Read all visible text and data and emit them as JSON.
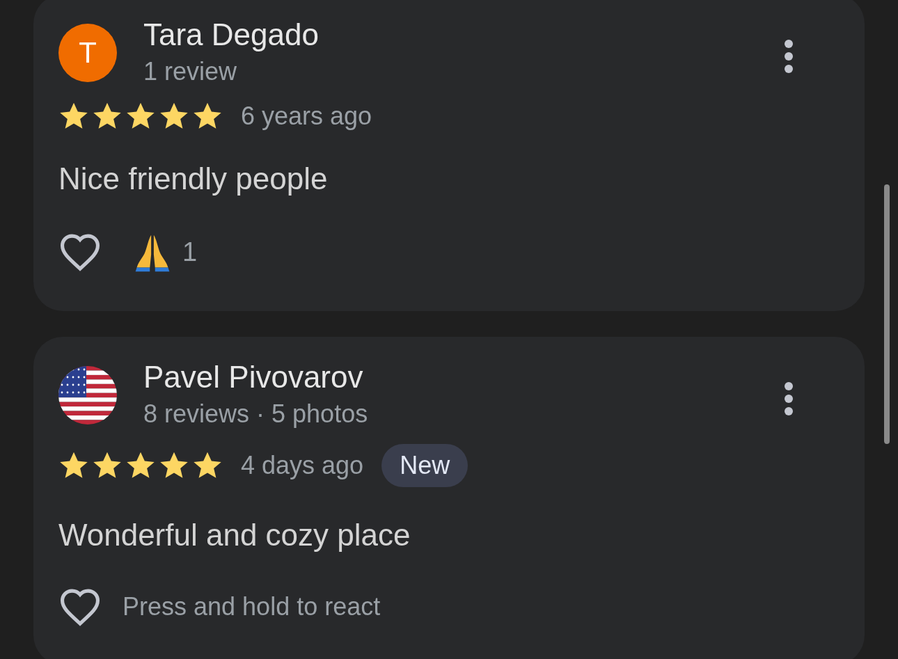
{
  "reviews": [
    {
      "avatar": {
        "kind": "letter",
        "letter": "T",
        "color": "#f06c00"
      },
      "name": "Tara Degado",
      "meta": "1 review",
      "stars": 5,
      "time": "6 years ago",
      "text": "Nice friendly people",
      "reactions": [
        {
          "kind": "praying",
          "count": "1"
        }
      ]
    },
    {
      "avatar": {
        "kind": "flag"
      },
      "name": "Pavel Pivovarov",
      "meta": "8 reviews · 5 photos",
      "stars": 5,
      "time": "4 days ago",
      "badge": "New",
      "text": "Wonderful and cozy place",
      "hint": "Press and hold to react"
    }
  ]
}
